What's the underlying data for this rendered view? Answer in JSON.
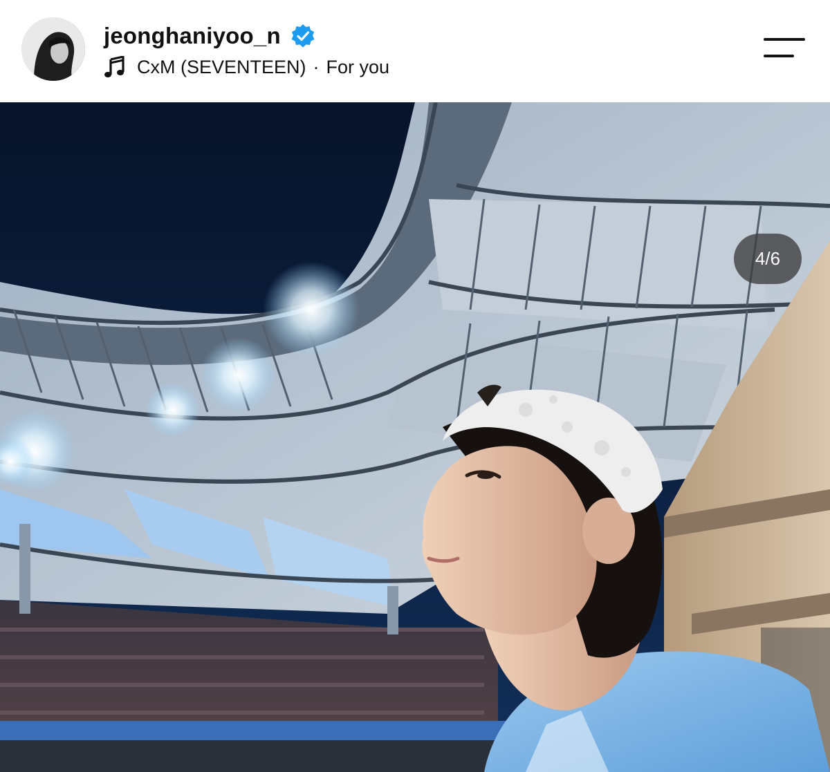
{
  "post": {
    "username": "jeonghaniyoo_n",
    "verified": true,
    "audio": {
      "artist": "CxM (SEVENTEEN)",
      "separator": "·",
      "track": "For you"
    }
  },
  "carousel": {
    "counter": "4/6",
    "current": 4,
    "total": 6
  },
  "icons": {
    "verified": "verified-badge-icon",
    "audio": "music-note-icon",
    "menu": "menu-icon"
  },
  "colors": {
    "verified_blue": "#1d9bf0",
    "text": "#111111",
    "counter_bg": "#3c3c3c",
    "jersey_blue": "#7fb6e6"
  }
}
